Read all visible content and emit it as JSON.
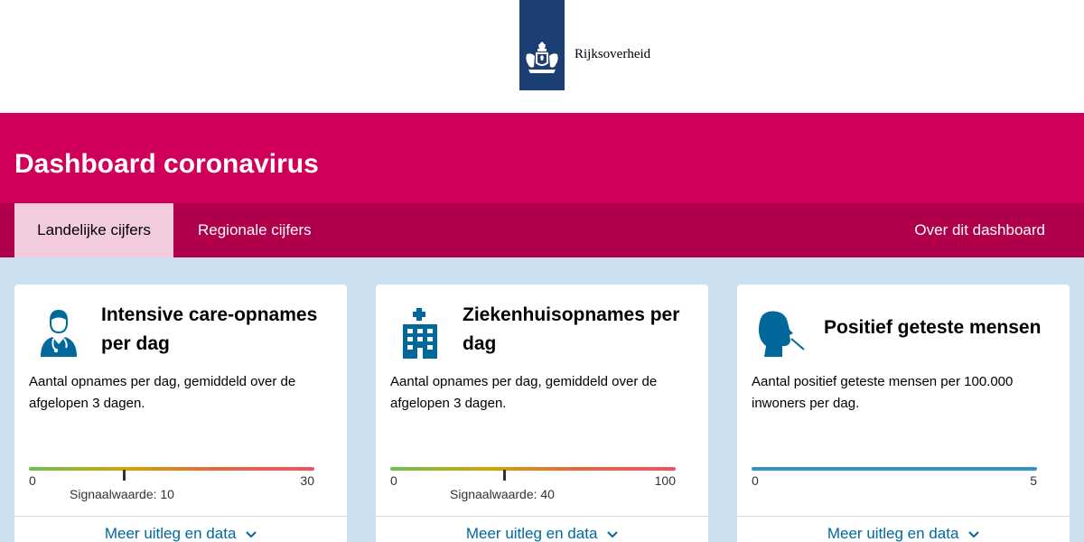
{
  "header": {
    "logo_text": "Rijksoverheid"
  },
  "hero": {
    "title": "Dashboard coronavirus"
  },
  "nav": {
    "tabs": [
      {
        "label": "Landelijke cijfers",
        "active": true
      },
      {
        "label": "Regionale cijfers",
        "active": false
      }
    ],
    "about": "Over dit dashboard"
  },
  "cards": [
    {
      "icon": "doctor-icon",
      "title": "Intensive care-opnames per dag",
      "description": "Aantal opnames per dag, gemiddeld over de afgelopen 3 dagen.",
      "scale": {
        "min": "0",
        "max": "30",
        "signal_label": "Signaalwaarde: 10",
        "signal_value": 10,
        "max_value": 30
      },
      "link": "Meer uitleg en data"
    },
    {
      "icon": "hospital-icon",
      "title": "Ziekenhuisopnames per dag",
      "description": "Aantal opnames per dag, gemiddeld over de afgelopen 3 dagen.",
      "scale": {
        "min": "0",
        "max": "100",
        "signal_label": "Signaalwaarde: 40",
        "signal_value": 40,
        "max_value": 100
      },
      "link": "Meer uitleg en data"
    },
    {
      "icon": "test-swab-icon",
      "title": "Positief geteste mensen",
      "description": "Aantal positief geteste mensen per 100.000 inwoners per dag.",
      "scale": {
        "min": "0",
        "max": "5"
      },
      "link": "Meer uitleg en data"
    }
  ],
  "colors": {
    "brand_magenta": "#d0005a",
    "nav_magenta": "#b0004b",
    "active_tab": "#f2ccdc",
    "page_bg": "#cce0f0",
    "link_blue": "#01689b",
    "logo_blue": "#1b3f73",
    "icon_blue": "#01689b"
  }
}
